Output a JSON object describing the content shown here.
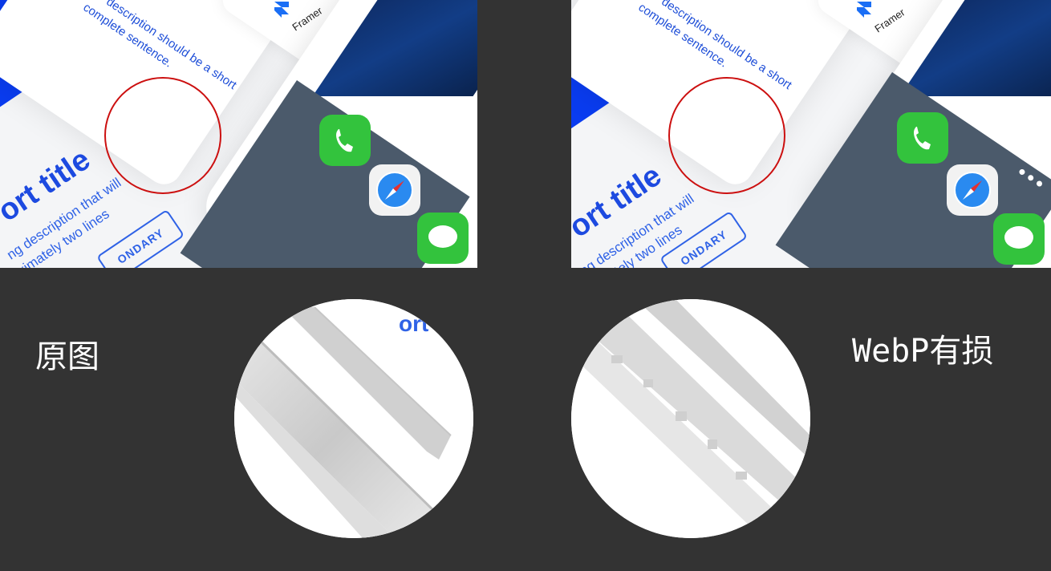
{
  "captions": {
    "left": "原图",
    "right": "WebP有损"
  },
  "card": {
    "description": [
      "description should be a short",
      "complete sentence."
    ],
    "title": "ort title",
    "subtitle": [
      "ng description that will",
      "ximately two lines"
    ],
    "secondary_button": "ONDARY"
  },
  "framer": {
    "label": "Framer",
    "partial_label": "Frame"
  },
  "phone": {
    "apps": [
      "phone-app",
      "safari-app",
      "messages-app"
    ],
    "page_dots": 3
  },
  "colors": {
    "background": "#333333",
    "highlight_circle": "#cc1010",
    "accent_blue": "#1d4ae0"
  }
}
